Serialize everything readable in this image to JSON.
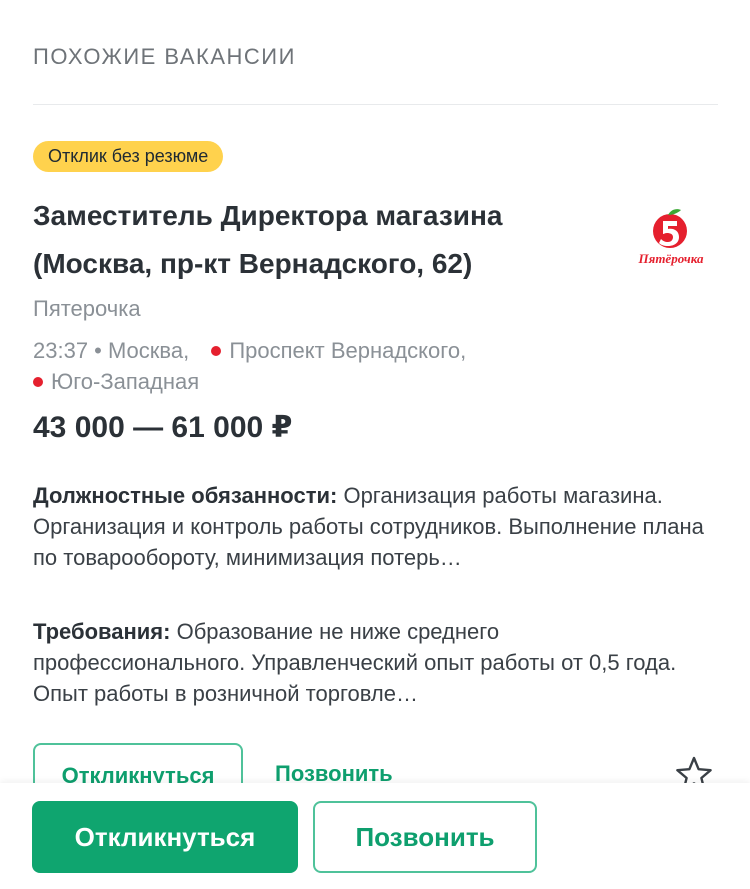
{
  "section": {
    "title": "ПОХОЖИЕ ВАКАНСИИ"
  },
  "vacancy": {
    "badge": "Отклик без резюме",
    "title": "Заместитель Директора магазина (Москва, пр-кт Вернадского, 62)",
    "company": "Пятерочка",
    "logo_text": "Пятёрочка",
    "logo_icon": "pyaterochka-logo",
    "time_city": "23:37 • Москва,",
    "metro_1": "Проспект Вернадского,",
    "metro_2": "Юго-Западная",
    "metro_color": "#e5202e",
    "salary": "43 000 — 61 000 ₽",
    "duties_label": "Должностные обязанности:",
    "duties_text": "Организация работы магазина. Организация и контроль работы сотрудников. Выполнение плана по товарообороту, минимизация потерь…",
    "requirements_label": "Требования:",
    "requirements_text": "Образование не ниже среднего профессионального. Управленческий опыт работы от 0,5 года. Опыт работы в розничной торговле…",
    "respond_label": "Откликнуться",
    "call_label": "Позвонить",
    "favorite_icon": "star-icon"
  },
  "bottom_bar": {
    "respond_label": "Откликнуться",
    "call_label": "Позвонить"
  },
  "colors": {
    "accent": "#0fa56f",
    "badge": "#ffd24d",
    "muted": "#8a9096"
  }
}
